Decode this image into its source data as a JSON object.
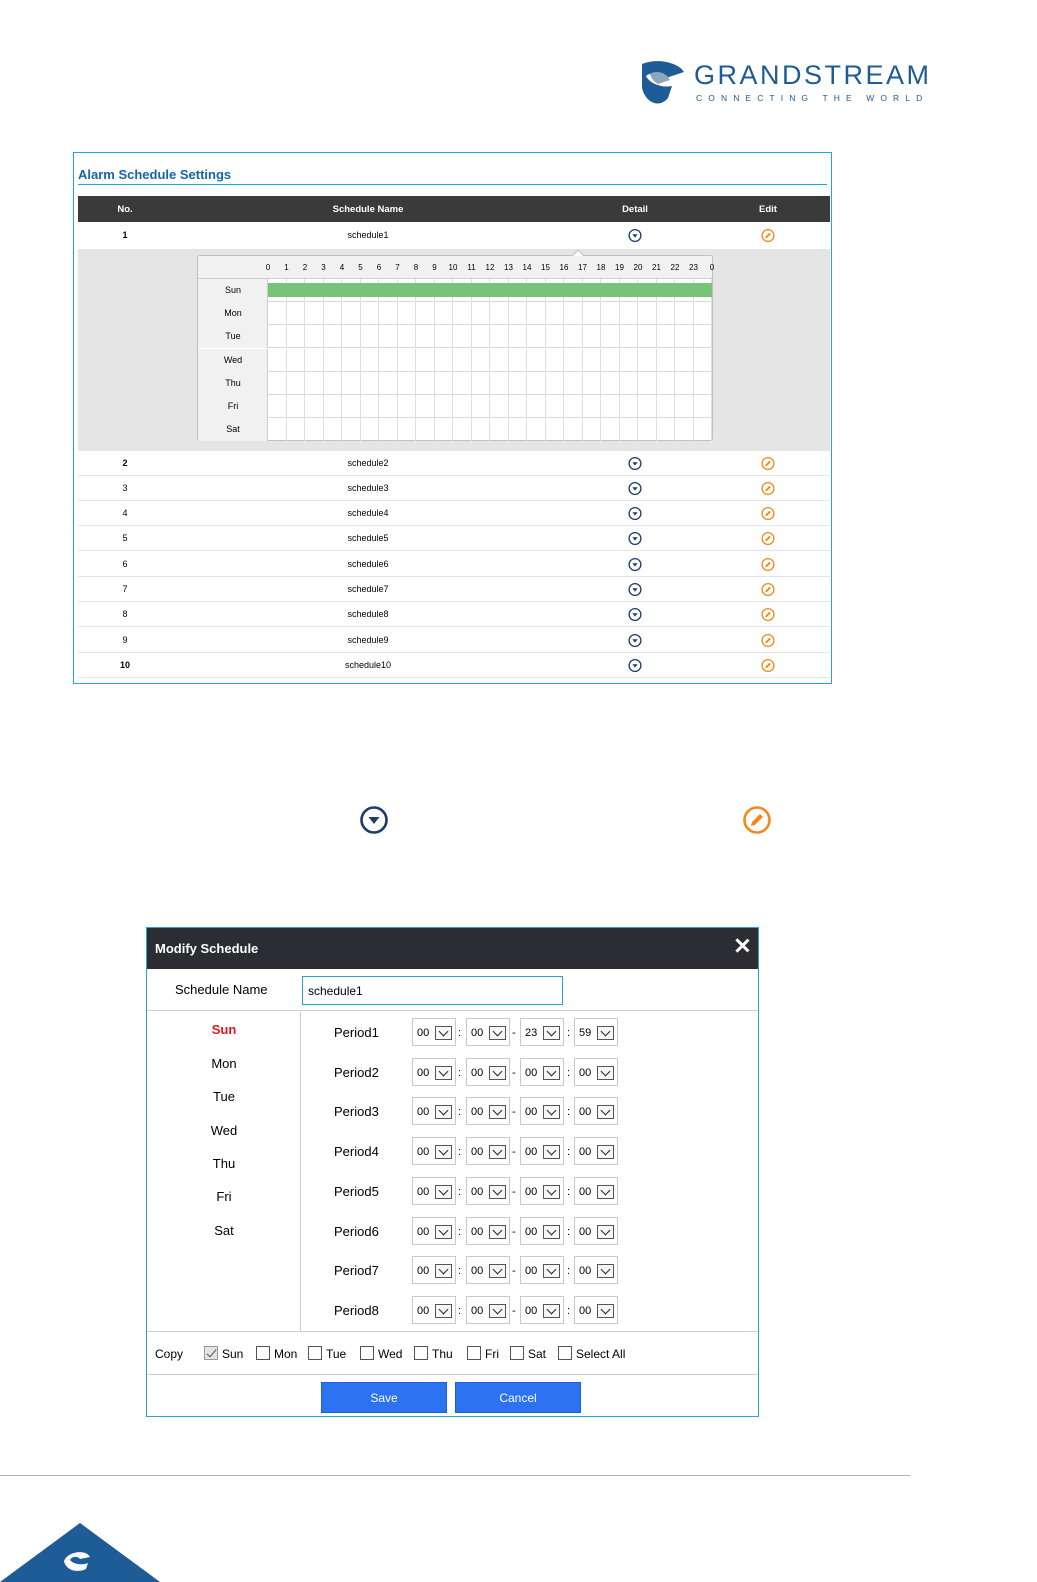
{
  "logo": {
    "wordmark": "GRANDSTREAM",
    "tagline": "CONNECTING THE WORLD",
    "brand_color": "#1d5c96"
  },
  "settings": {
    "title": "Alarm Schedule Settings",
    "headers": {
      "no": "No.",
      "name": "Schedule Name",
      "detail": "Detail",
      "edit": "Edit"
    },
    "detail_icon": "chevron-down-circle-icon",
    "edit_icon": "pencil-circle-icon",
    "rows": [
      {
        "no": "1",
        "name": "schedule1"
      },
      {
        "no": "2",
        "name": "schedule2"
      },
      {
        "no": "3",
        "name": "schedule3"
      },
      {
        "no": "4",
        "name": "schedule4"
      },
      {
        "no": "5",
        "name": "schedule5"
      },
      {
        "no": "6",
        "name": "schedule6"
      },
      {
        "no": "7",
        "name": "schedule7"
      },
      {
        "no": "8",
        "name": "schedule8"
      },
      {
        "no": "9",
        "name": "schedule9"
      },
      {
        "no": "10",
        "name": "schedule10"
      }
    ],
    "detail": {
      "hours": [
        "0",
        "1",
        "2",
        "3",
        "4",
        "5",
        "6",
        "7",
        "8",
        "9",
        "10",
        "11",
        "12",
        "13",
        "14",
        "15",
        "16",
        "17",
        "18",
        "19",
        "20",
        "21",
        "22",
        "23",
        "0"
      ],
      "days": [
        "Sun",
        "Mon",
        "Tue",
        "Wed",
        "Thu",
        "Fri",
        "Sat"
      ],
      "active_day": "Sun",
      "active_color": "#77c377"
    }
  },
  "dialog": {
    "title": "Modify Schedule",
    "name_label": "Schedule Name",
    "name_value": "schedule1",
    "days": [
      "Sun",
      "Mon",
      "Tue",
      "Wed",
      "Thu",
      "Fri",
      "Sat"
    ],
    "selected_day": "Sun",
    "periods": [
      {
        "label": "Period1",
        "values": [
          "00",
          "00",
          "23",
          "59"
        ]
      },
      {
        "label": "Period2",
        "values": [
          "00",
          "00",
          "00",
          "00"
        ]
      },
      {
        "label": "Period3",
        "values": [
          "00",
          "00",
          "00",
          "00"
        ]
      },
      {
        "label": "Period4",
        "values": [
          "00",
          "00",
          "00",
          "00"
        ]
      },
      {
        "label": "Period5",
        "values": [
          "00",
          "00",
          "00",
          "00"
        ]
      },
      {
        "label": "Period6",
        "values": [
          "00",
          "00",
          "00",
          "00"
        ]
      },
      {
        "label": "Period7",
        "values": [
          "00",
          "00",
          "00",
          "00"
        ]
      },
      {
        "label": "Period8",
        "values": [
          "00",
          "00",
          "00",
          "00"
        ]
      }
    ],
    "copy_label": "Copy",
    "copy_options": [
      {
        "label": "Sun",
        "checked": true
      },
      {
        "label": "Mon",
        "checked": false
      },
      {
        "label": "Tue",
        "checked": false
      },
      {
        "label": "Wed",
        "checked": false
      },
      {
        "label": "Thu",
        "checked": false
      },
      {
        "label": "Fri",
        "checked": false
      },
      {
        "label": "Sat",
        "checked": false
      },
      {
        "label": "Select All",
        "checked": false
      }
    ],
    "save_label": "Save",
    "cancel_label": "Cancel",
    "accent_color": "#2d72f0",
    "selected_day_color": "#e8141b"
  }
}
